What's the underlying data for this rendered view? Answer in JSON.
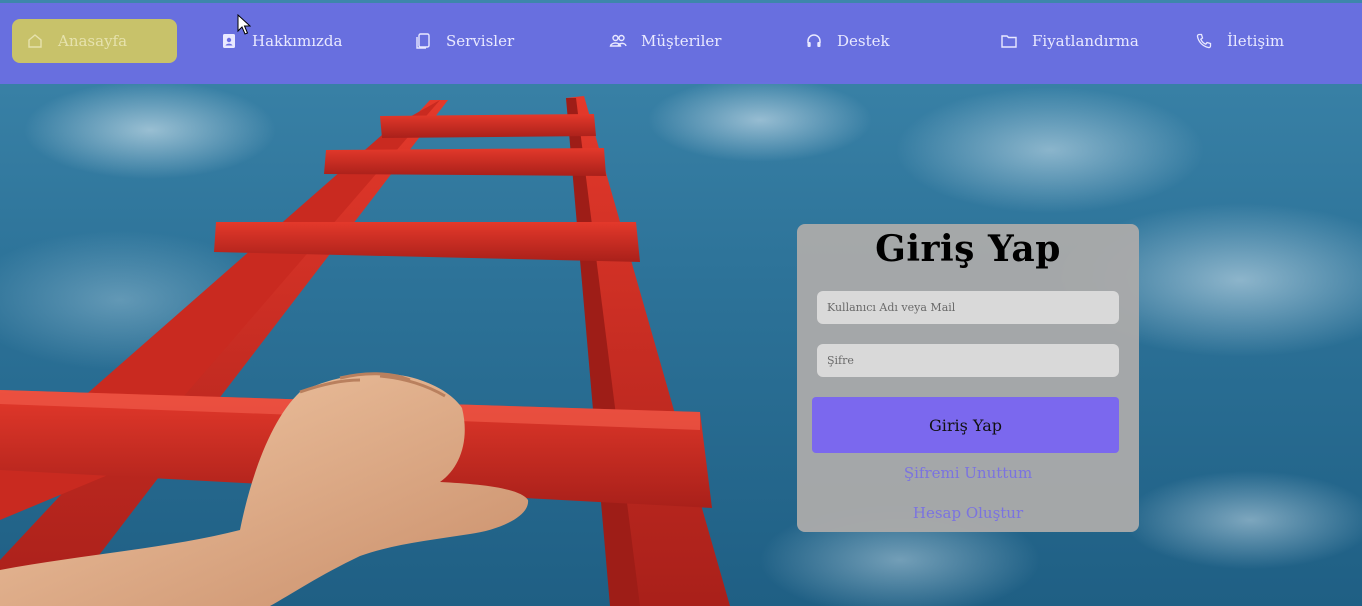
{
  "nav": {
    "items": [
      {
        "label": "Anasayfa",
        "icon": "home-icon",
        "active": true
      },
      {
        "label": "Hakkımızda",
        "icon": "contact-card-icon",
        "active": false
      },
      {
        "label": "Servisler",
        "icon": "copy-icon",
        "active": false
      },
      {
        "label": "Müşteriler",
        "icon": "users-icon",
        "active": false
      },
      {
        "label": "Destek",
        "icon": "headphones-icon",
        "active": false
      },
      {
        "label": "Fiyatlandırma",
        "icon": "folder-icon",
        "active": false
      },
      {
        "label": "İletişim",
        "icon": "phone-icon",
        "active": false
      }
    ]
  },
  "login": {
    "title": "Giriş Yap",
    "username_placeholder": "Kullanıcı Adı veya Mail",
    "password_placeholder": "Şifre",
    "submit_label": "Giriş Yap",
    "forgot_label": "Şifremi Unuttum",
    "register_label": "Hesap Oluştur"
  },
  "colors": {
    "nav_bg": "#6c6ee4",
    "nav_active": "#c8c26a",
    "button": "#7b68ee",
    "card": "#aaaaaa",
    "link": "#7b73e0"
  }
}
